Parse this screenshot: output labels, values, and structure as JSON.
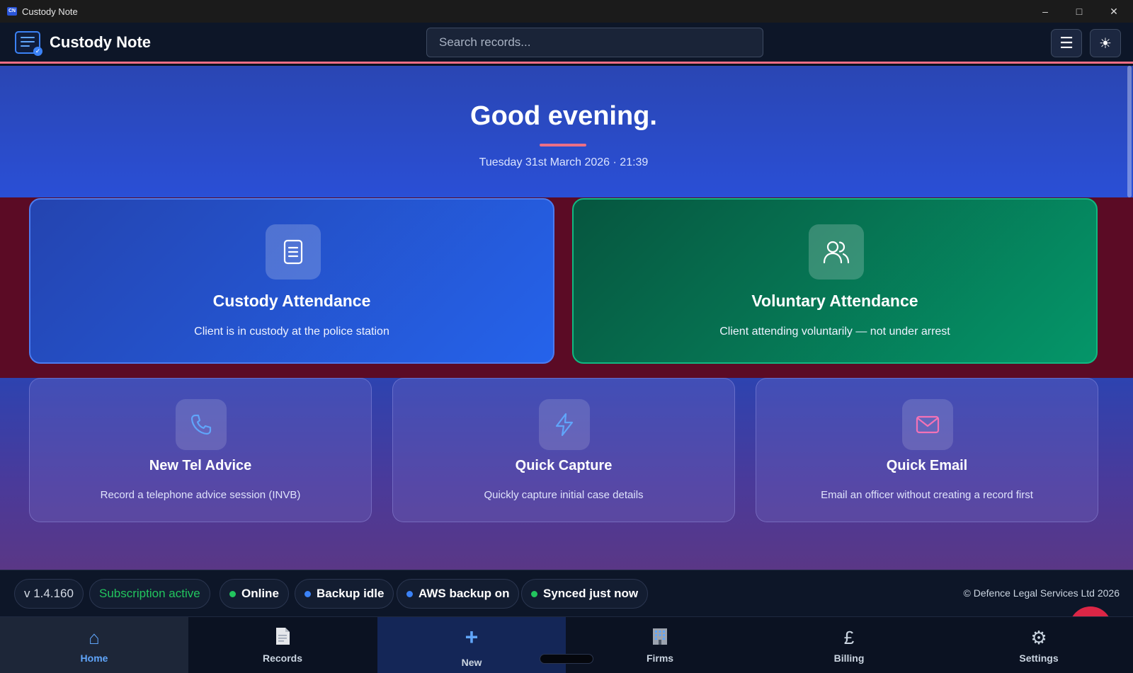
{
  "window": {
    "title": "Custody Note",
    "icon_text": "CN"
  },
  "header": {
    "brand": "Custody Note",
    "search_placeholder": "Search records...",
    "menu_icon": "hamburger-icon",
    "theme_icon": "sun-icon"
  },
  "hero": {
    "greeting": "Good evening.",
    "datetime": "Tuesday 31st March 2026 · 21:39"
  },
  "cards": {
    "custody": {
      "title": "Custody Attendance",
      "desc": "Client is in custody at the police station",
      "icon": "document-icon"
    },
    "voluntary": {
      "title": "Voluntary Attendance",
      "desc": "Client attending voluntarily — not under arrest",
      "icon": "users-icon"
    },
    "tel": {
      "title": "New Tel Advice",
      "desc": "Record a telephone advice session (INVB)",
      "icon": "phone-icon"
    },
    "capture": {
      "title": "Quick Capture",
      "desc": "Quickly capture initial case details",
      "icon": "lightning-icon"
    },
    "email": {
      "title": "Quick Email",
      "desc": "Email an officer without creating a record first",
      "icon": "mail-icon"
    }
  },
  "status": {
    "version": "v 1.4.160",
    "subscription": "Subscription active",
    "online": "Online",
    "backup": "Backup idle",
    "aws": "AWS backup on",
    "synced": "Synced just now",
    "copyright": "© Defence Legal Services Ltd 2026",
    "colors": {
      "green": "#22c55e",
      "blue": "#3b82f6",
      "subscription_text": "#22c55e"
    }
  },
  "nav": {
    "home": "Home",
    "records": "Records",
    "new": "New",
    "firms": "Firms",
    "billing": "Billing",
    "settings": "Settings"
  },
  "colors": {
    "accent": "#ec6f86",
    "brand_blue": "#2563eb",
    "brand_green": "#059669"
  }
}
